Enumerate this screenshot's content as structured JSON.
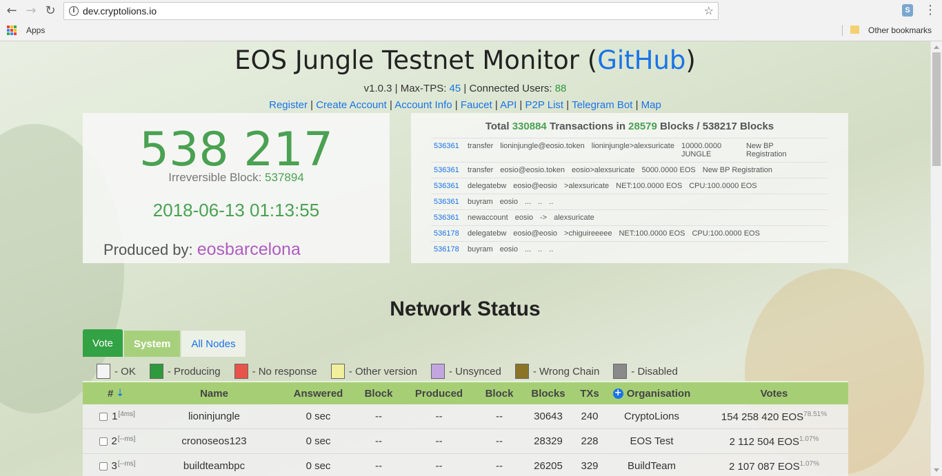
{
  "browser": {
    "url": "dev.cryptolions.io",
    "bookmarks": {
      "apps_label": "Apps",
      "other_label": "Other bookmarks"
    }
  },
  "header": {
    "title": "EOS Jungle Testnet Monitor (",
    "github": "GitHub",
    "title_end": ")",
    "version": "v1.0.3 | Max-TPS: ",
    "max_tps": "45",
    "connected_label": " | Connected Users: ",
    "connected_users": "88",
    "links": [
      "Register",
      "Create Account",
      "Account Info",
      "Faucet",
      "API",
      "P2P List",
      "Telegram Bot",
      "Map"
    ]
  },
  "block": {
    "number": "538 217",
    "irreversible_label": "Irreversible Block: ",
    "irreversible": "537894",
    "timestamp": "2018-06-13 01:13:55",
    "produced_label": "Produced by: ",
    "producer": "eosbarcelona"
  },
  "transactions": {
    "head_total": "Total ",
    "total_tx": "330884",
    "head_tx": " Transactions in ",
    "blocks_with_tx": "28579",
    "head_blocks": " Blocks / 538217 Blocks",
    "rows": [
      {
        "block": "536361",
        "action": "transfer",
        "account": "lioninjungle@eosio.token",
        "detail": "lioninjungle>alexsuricate",
        "amount": "10000.0000 JUNGLE",
        "memo": "New BP Registration"
      },
      {
        "block": "536361",
        "action": "transfer",
        "account": "eosio@eosio.token",
        "detail": "eosio>alexsuricate",
        "amount": "5000.0000 EOS",
        "memo": "New BP Registration"
      },
      {
        "block": "536361",
        "action": "delegatebw",
        "account": "eosio@eosio",
        "detail": ">alexsuricate",
        "amount": "NET:100.0000 EOS",
        "memo": "CPU:100.0000 EOS"
      },
      {
        "block": "536361",
        "action": "buyram",
        "account": "eosio",
        "detail": "...",
        "amount": "..",
        "memo": ".."
      },
      {
        "block": "536361",
        "action": "newaccount",
        "account": "eosio",
        "detail": "->",
        "amount": "alexsuricate",
        "memo": ""
      },
      {
        "block": "536178",
        "action": "delegatebw",
        "account": "eosio@eosio",
        "detail": ">chiguireeeee",
        "amount": "NET:100.0000 EOS",
        "memo": "CPU:100.0000 EOS"
      },
      {
        "block": "536178",
        "action": "buyram",
        "account": "eosio",
        "detail": "...",
        "amount": "..",
        "memo": ".."
      }
    ]
  },
  "network": {
    "title": "Network Status",
    "tabs": [
      "Vote",
      "System",
      "All Nodes"
    ],
    "legend": [
      {
        "label": "- OK",
        "color": "#f4f4f4"
      },
      {
        "label": "- Producing",
        "color": "#2e9a3d"
      },
      {
        "label": "- No response",
        "color": "#e8534a"
      },
      {
        "label": "- Other version",
        "color": "#f1ef9c"
      },
      {
        "label": "- Unsynced",
        "color": "#c3a6df"
      },
      {
        "label": "- Wrong Chain",
        "color": "#8a7426"
      },
      {
        "label": "- Disabled",
        "color": "#8a8a8a"
      }
    ],
    "columns": {
      "num": "#",
      "name": "Name",
      "answered": "Answered",
      "block": "Block",
      "produced": "Produced",
      "block2": "Block",
      "blocks": "Blocks",
      "txs": "TXs",
      "organisation": "Organisation",
      "votes": "Votes"
    },
    "rows": [
      {
        "num": "1",
        "ping": "[4ms]",
        "name": "lioninjungle",
        "answered": "0 sec",
        "block": "--",
        "produced": "--",
        "block2": "--",
        "blocks": "30643",
        "txs": "240",
        "org": "CryptoLions",
        "votes": "154 258 420 EOS",
        "pct": "78.51%"
      },
      {
        "num": "2",
        "ping": "[--ms]",
        "name": "cronoseos123",
        "answered": "0 sec",
        "block": "--",
        "produced": "--",
        "block2": "--",
        "blocks": "28329",
        "txs": "228",
        "org": "EOS Test",
        "votes": "2 112 504 EOS",
        "pct": "1.07%"
      },
      {
        "num": "3",
        "ping": "[--ms]",
        "name": "buildteambpc",
        "answered": "0 sec",
        "block": "--",
        "produced": "--",
        "block2": "--",
        "blocks": "26205",
        "txs": "329",
        "org": "BuildTeam",
        "votes": "2 107 087 EOS",
        "pct": "1.07%"
      }
    ]
  }
}
